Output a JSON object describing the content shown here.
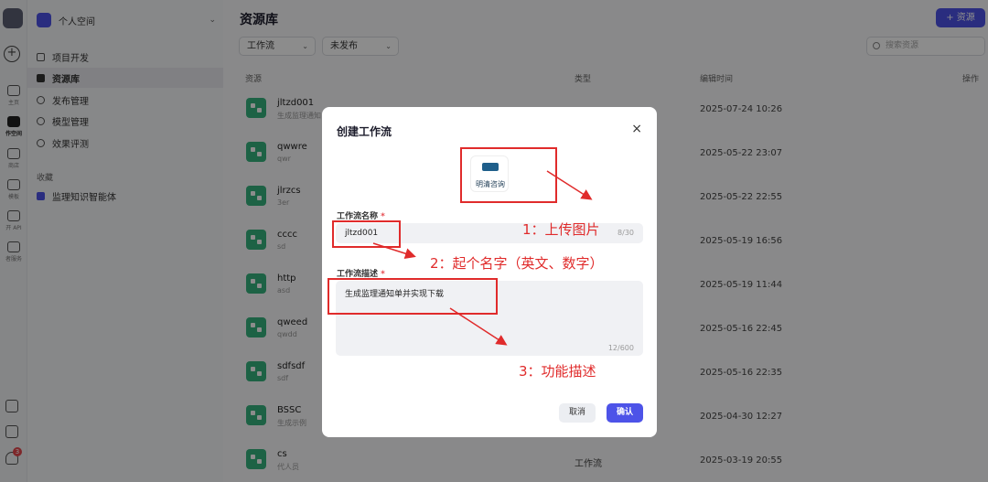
{
  "sidebar": {
    "space_name": "个人空间",
    "nav": [
      {
        "label": "项目开发"
      },
      {
        "label": "资源库"
      },
      {
        "label": "发布管理"
      },
      {
        "label": "模型管理"
      },
      {
        "label": "效果评测"
      }
    ],
    "favorites_label": "收藏",
    "favorites": [
      {
        "label": "监理知识智能体"
      }
    ]
  },
  "rail": {
    "items": [
      "主页",
      "作空间",
      "商店",
      "模板",
      "开 API",
      "者服务"
    ],
    "notification_count": "3"
  },
  "main": {
    "title": "资源库",
    "add_button": "+ 资源",
    "filters": [
      "工作流",
      "未发布"
    ],
    "search_placeholder": "搜索资源",
    "columns": [
      "资源",
      "类型",
      "编辑时间",
      "操作"
    ],
    "rows": [
      {
        "name": "jltzd001",
        "desc": "生成监理通知",
        "type": "",
        "time": "2025-07-24 10:26"
      },
      {
        "name": "qwwre",
        "desc": "qwr",
        "type": "",
        "time": "2025-05-22 23:07"
      },
      {
        "name": "jlrzcs",
        "desc": "3er",
        "type": "",
        "time": "2025-05-22 22:55"
      },
      {
        "name": "cccc",
        "desc": "sd",
        "type": "",
        "time": "2025-05-19 16:56"
      },
      {
        "name": "http",
        "desc": "asd",
        "type": "",
        "time": "2025-05-19 11:44"
      },
      {
        "name": "qweed",
        "desc": "qwdd",
        "type": "",
        "time": "2025-05-16 22:45"
      },
      {
        "name": "sdfsdf",
        "desc": "sdf",
        "type": "",
        "time": "2025-05-16 22:35"
      },
      {
        "name": "BSSC",
        "desc": "生成示例",
        "type": "",
        "time": "2025-04-30 12:27"
      },
      {
        "name": "cs",
        "desc": "代人员",
        "type": "工作流",
        "time": "2025-03-19 20:55"
      }
    ]
  },
  "modal": {
    "title": "创建工作流",
    "close": "×",
    "logo_text": "明清咨询",
    "name_label": "工作流名称",
    "name_value": "jltzd001",
    "name_count": "8/30",
    "desc_label": "工作流描述",
    "desc_value": "生成监理通知单并实现下载",
    "desc_count": "12/600",
    "required_mark": "*",
    "cancel": "取消",
    "confirm": "确认"
  },
  "annotations": {
    "step1": "1：上传图片",
    "step2": "2：起个名字（英文、数字）",
    "step3": "3：功能描述",
    "color": "#e02b2b"
  }
}
